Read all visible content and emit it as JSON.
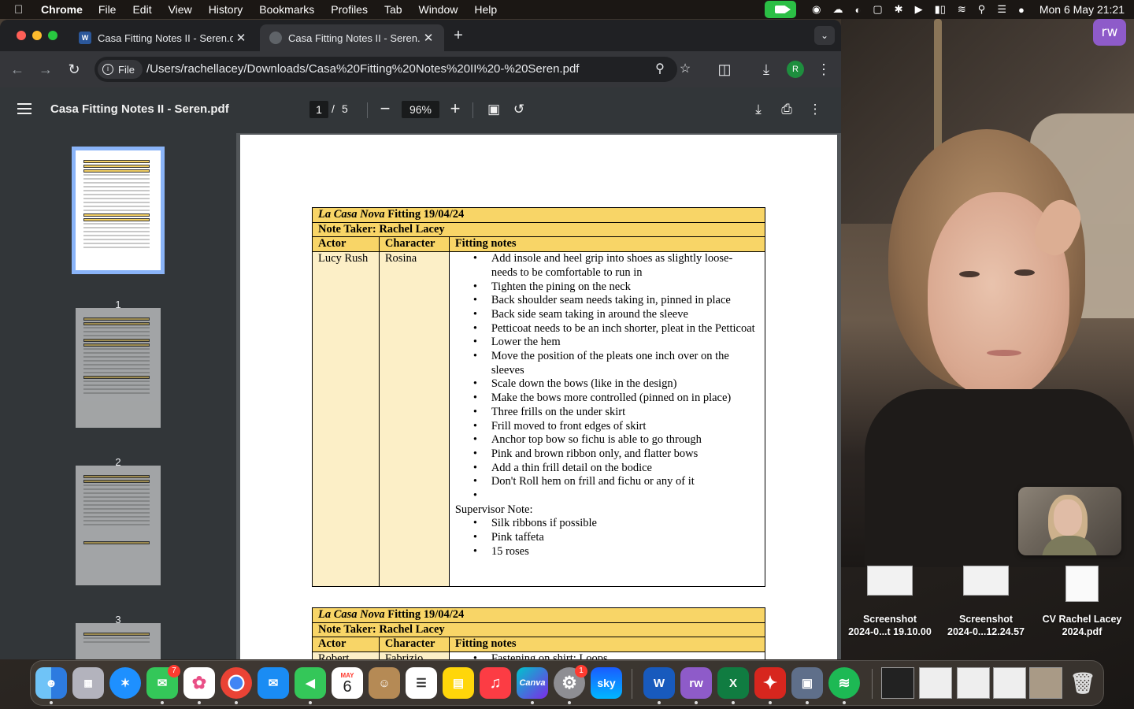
{
  "menubar": {
    "app": "Chrome",
    "items": [
      "File",
      "Edit",
      "View",
      "History",
      "Bookmarks",
      "Profiles",
      "Tab",
      "Window",
      "Help"
    ],
    "datetime": "Mon 6 May  21:21"
  },
  "tabs": [
    {
      "title": "Casa Fitting Notes II - Seren.d",
      "favicon": "W"
    },
    {
      "title": "Casa Fitting Notes II - Seren.p"
    }
  ],
  "toolbar": {
    "file_chip": "File",
    "url": "/Users/rachellacey/Downloads/Casa%20Fitting%20Notes%20II%20-%20Seren.pdf",
    "profile_initial": "R"
  },
  "pdf": {
    "title": "Casa Fitting Notes II - Seren.pdf",
    "current_page": "1",
    "page_sep": "/",
    "total_pages": "5",
    "zoom": "96%",
    "thumb_labels": [
      "1",
      "2",
      "3"
    ]
  },
  "table1": {
    "title_italic": "La Casa Nova",
    "title_rest": " Fitting 19/04/24",
    "note_taker": "Note Taker: Rachel Lacey",
    "col_actor": "Actor",
    "col_character": "Character",
    "col_notes": "Fitting notes",
    "actor": "Lucy Rush",
    "character": "Rosina",
    "notes": [
      "Add insole and heel grip into shoes as slightly loose- needs to be comfortable to run in",
      " Tighten the pining on the neck",
      "Back shoulder seam needs taking in, pinned in place",
      "Back side seam taking in around the sleeve",
      "Petticoat needs to be an inch shorter, pleat in the Petticoat",
      "Lower the hem",
      "Move the position of the pleats one inch over on the sleeves",
      "Scale down the bows (like in the design)",
      "Make the bows more controlled (pinned on in place)",
      "Three frills on the under skirt",
      "Frill moved to front edges of skirt",
      "Anchor top bow so fichu is able to go through",
      "Pink and brown ribbon only, and flatter bows",
      "Add a thin frill detail on the bodice",
      "Don't Roll hem on frill and fichu or any of it",
      ""
    ],
    "supervisor_label": "Supervisor Note:",
    "supervisor_notes": [
      "Silk ribbons if possible",
      "Pink taffeta",
      "15 roses"
    ]
  },
  "table2": {
    "title_italic": "La Casa Nova",
    "title_rest": " Fitting 19/04/24",
    "note_taker": "Note Taker: Rachel Lacey",
    "col_actor": "Actor",
    "col_character": "Character",
    "col_notes": "Fitting notes",
    "actor": "Robert",
    "character": "Fabrizio",
    "first_note": "Fastening on shirt: Loops"
  },
  "desktop_files": [
    {
      "line1": "Screenshot",
      "line2": "2024-0...t 19.10.00"
    },
    {
      "line1": "Screenshot",
      "line2": "2024-0...12.24.57"
    },
    {
      "line1": "CV Rachel Lacey",
      "line2": "2024.pdf"
    }
  ],
  "overlay": {
    "rw": "rw"
  },
  "dock": {
    "messages_badge": "7",
    "settings_badge": "1",
    "calendar_month": "MAY",
    "calendar_day": "6",
    "canva": "Canva",
    "sky": "sky",
    "word": "W",
    "excel": "X",
    "rw": "rw"
  },
  "colors": {
    "table_header": "#f8d567",
    "table_pale": "#fcefc7",
    "thumb_selected": "#8ab4f8"
  }
}
